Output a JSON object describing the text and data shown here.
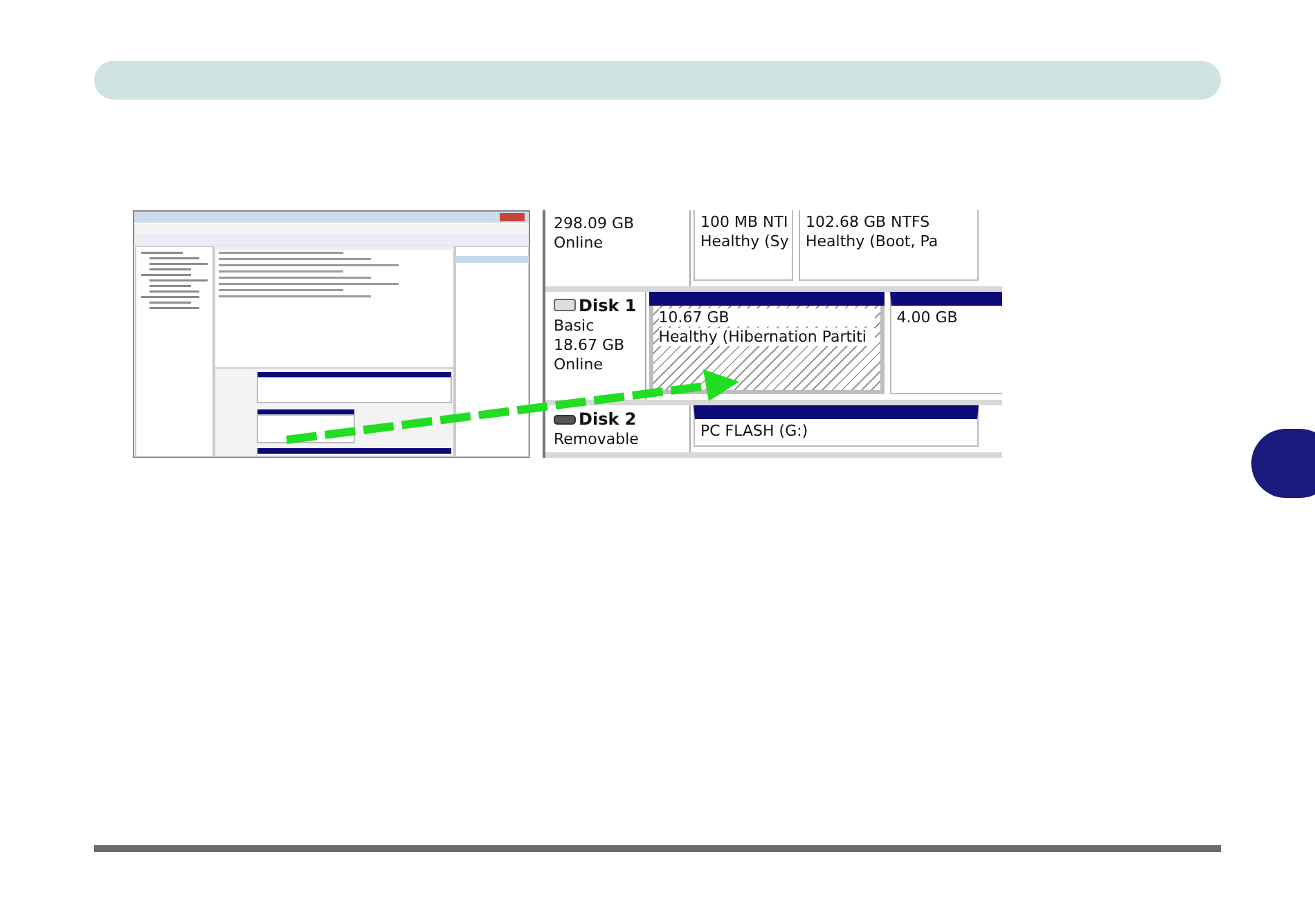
{
  "zoom_panel": {
    "disks": [
      {
        "info": [
          "298.09 GB",
          "Online"
        ],
        "partitions": [
          {
            "kind": "primary",
            "lines": [
              "100 MB NTI",
              "Healthy (Sy"
            ]
          },
          {
            "kind": "primary",
            "lines": [
              "102.68 GB NTFS",
              "Healthy (Boot, Pa"
            ]
          }
        ]
      },
      {
        "name": "Disk 1",
        "kind": "fixed",
        "info": [
          "Basic",
          "18.67 GB",
          "Online"
        ],
        "partitions": [
          {
            "kind": "hatched",
            "lines": [
              "10.67 GB",
              "Healthy (Hibernation Partiti"
            ]
          },
          {
            "kind": "primary",
            "lines": [
              "4.00 GB"
            ]
          }
        ]
      },
      {
        "name": "Disk 2",
        "kind": "removable",
        "info": [
          "Removable"
        ],
        "partitions": [
          {
            "kind": "primary",
            "lines": [
              "PC FLASH (G:)"
            ]
          }
        ]
      }
    ]
  }
}
